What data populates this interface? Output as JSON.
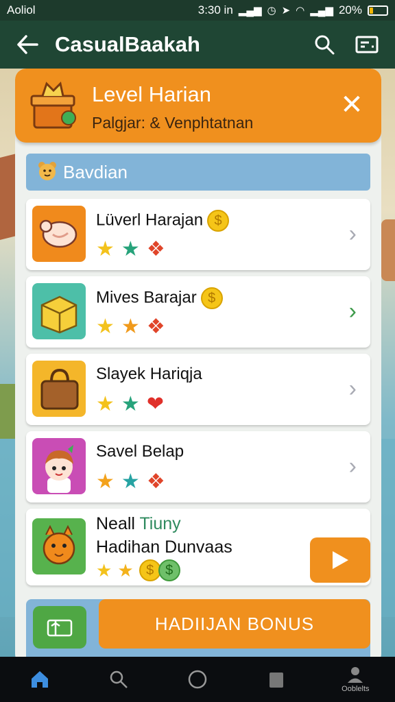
{
  "status_bar": {
    "carrier": "Aoliol",
    "time": "3:30 in",
    "battery": "20%",
    "battery_level": 0.2
  },
  "app_bar": {
    "title": "CasualBaakah",
    "back_icon": "back-arrow-icon",
    "search_icon": "search-icon",
    "menu_icon": "card-menu-icon"
  },
  "header": {
    "title": "Level Harian",
    "subtitle": "Palgjar: & Venphtatnan",
    "icon": "gift-box-icon",
    "close_icon": "close-icon"
  },
  "section": {
    "label": "Bavdian",
    "icon": "bear-face-icon"
  },
  "items": [
    {
      "name": "Lüverl Harajan",
      "thumb_color": "#f08a1c",
      "icon": "candy-icon",
      "coin": true,
      "chevron_color": "#a8aab3"
    },
    {
      "name": "Mives Barajar",
      "thumb_color": "#4dbfa8",
      "icon": "golden-crate-icon",
      "coin": true,
      "chevron_color": "#3d9a4a"
    },
    {
      "name": "Slayek Hariqja",
      "thumb_color": "#f4b62a",
      "icon": "bag-icon",
      "coin": false,
      "chevron_color": "#a8aab3"
    },
    {
      "name": "Savel Belap",
      "thumb_color": "#c94db5",
      "icon": "character-icon",
      "coin": false,
      "chevron_color": "#a8aab3"
    }
  ],
  "bonus_item": {
    "name_line1_a": "Neall ",
    "name_line1_b": "Tiuny",
    "name_line2": "Hadihan Dunvaas",
    "thumb_color": "#57b24d",
    "icon": "orange-cat-icon",
    "play_icon": "play-icon"
  },
  "bottom": {
    "gift_icon": "gift-ticket-icon",
    "bonus_label": "HADIIJAN BONUS"
  },
  "nav": {
    "items": [
      {
        "icon": "home-icon",
        "active": true
      },
      {
        "icon": "search-icon",
        "active": false
      },
      {
        "icon": "circle-icon",
        "active": false
      },
      {
        "icon": "square-icon",
        "active": false
      },
      {
        "icon": "profile-icon",
        "active": false,
        "label": "Ooblelts"
      }
    ]
  },
  "colors": {
    "orange": "#f0901e",
    "dark_green": "#1f4634",
    "section_blue": "#82b4d8"
  }
}
